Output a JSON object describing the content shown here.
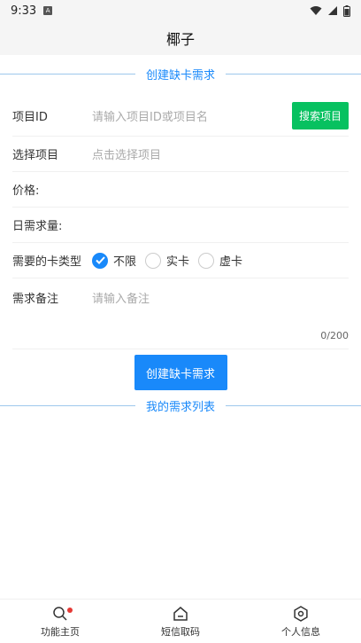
{
  "status": {
    "time": "9:33",
    "badge": "A"
  },
  "app": {
    "title": "椰子"
  },
  "create_section": {
    "title": "创建缺卡需求",
    "project_id_label": "项目ID",
    "project_id_placeholder": "请输入项目ID或项目名",
    "search_button": "搜索项目",
    "select_project_label": "选择项目",
    "select_project_placeholder": "点击选择项目",
    "price_label": "价格:",
    "daily_demand_label": "日需求量:",
    "card_type_label": "需要的卡类型",
    "card_types": [
      {
        "label": "不限",
        "checked": true
      },
      {
        "label": "实卡",
        "checked": false
      },
      {
        "label": "虚卡",
        "checked": false
      }
    ],
    "note_label": "需求备注",
    "note_placeholder": "请输入备注",
    "note_counter": "0/200",
    "submit_button": "创建缺卡需求"
  },
  "list_section": {
    "title": "我的需求列表"
  },
  "tabbar": {
    "tabs": [
      {
        "label": "功能主页",
        "icon": "search-icon"
      },
      {
        "label": "短信取码",
        "icon": "home-icon"
      },
      {
        "label": "个人信息",
        "icon": "gear-icon"
      }
    ]
  },
  "colors": {
    "accent": "#1989fa",
    "success": "#07c160",
    "badge_dot": "#e53935"
  }
}
